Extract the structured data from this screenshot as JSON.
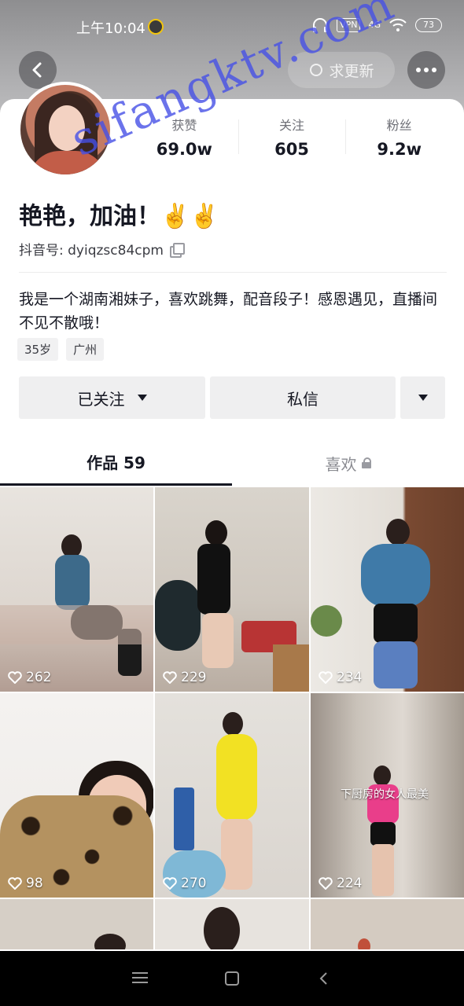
{
  "status_bar": {
    "time": "上午10:04",
    "vpn": "VPN",
    "network": "4G",
    "battery": "73"
  },
  "header": {
    "update_button_label": "求更新"
  },
  "profile": {
    "stats": [
      {
        "label": "获赞",
        "value": "69.0w"
      },
      {
        "label": "关注",
        "value": "605"
      },
      {
        "label": "粉丝",
        "value": "9.2w"
      }
    ],
    "nickname": "艳艳，加油！✌️✌️",
    "douyin_id": "抖音号: dyiqzsc84cpm",
    "bio": "我是一个湖南湘妹子，喜欢跳舞，配音段子！感恩遇见，直播间不见不散哦！",
    "tags": [
      "35岁",
      "广州"
    ]
  },
  "actions": {
    "follow_label": "已关注",
    "message_label": "私信"
  },
  "tabs": [
    {
      "label": "作品 59",
      "active": true
    },
    {
      "label": "喜欢",
      "active": false,
      "locked": true
    }
  ],
  "videos": [
    {
      "likes": "262"
    },
    {
      "likes": "229"
    },
    {
      "likes": "234"
    },
    {
      "likes": "98"
    },
    {
      "likes": "270"
    },
    {
      "likes": "224",
      "caption": "下厨房的女人最美"
    }
  ],
  "watermark": "sifangktv.com",
  "colors": {
    "text_primary": "#161823",
    "button_bg": "#efeff0",
    "watermark": "#4650e6"
  }
}
